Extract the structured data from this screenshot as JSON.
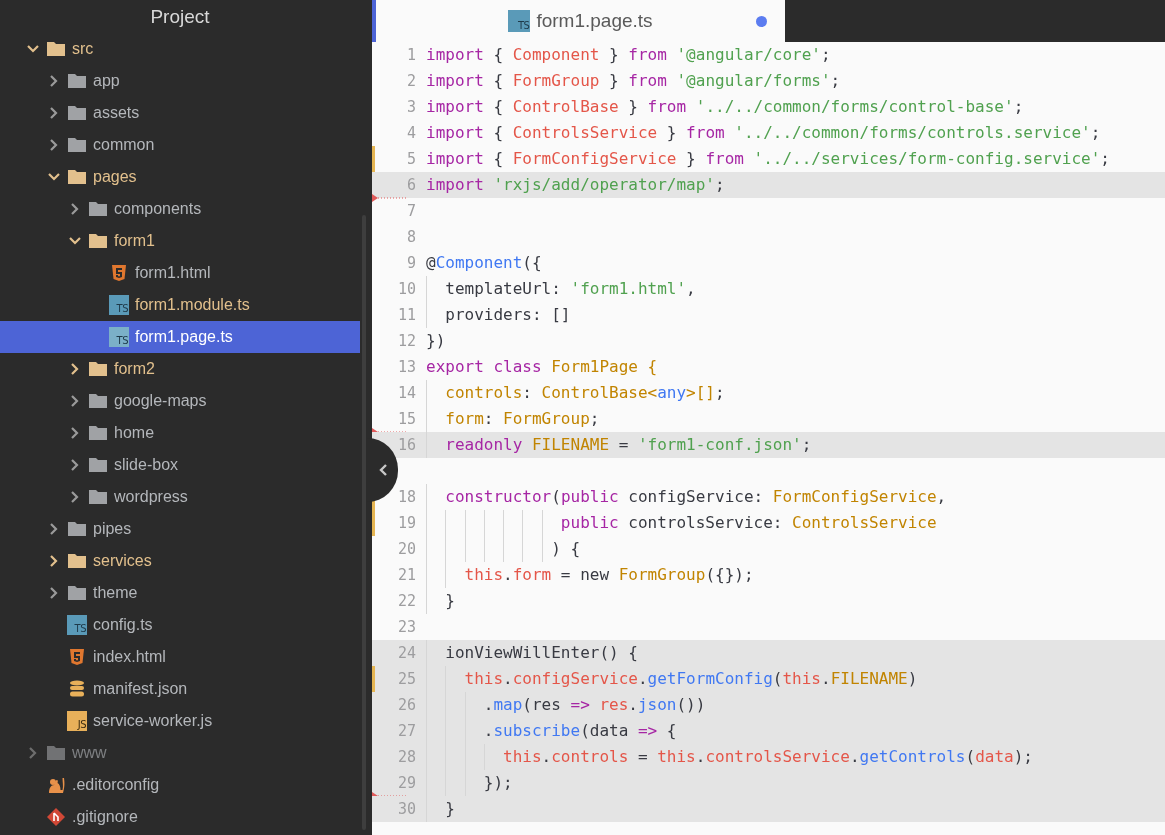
{
  "sidebar": {
    "title": "Project",
    "items": [
      {
        "kind": "folder",
        "label": "src",
        "expanded": true,
        "modified": true,
        "ignored": false,
        "selected": false,
        "children": [
          {
            "kind": "folder",
            "label": "app",
            "expanded": false,
            "modified": false,
            "ignored": false,
            "selected": false
          },
          {
            "kind": "folder",
            "label": "assets",
            "expanded": false,
            "modified": false,
            "ignored": false,
            "selected": false
          },
          {
            "kind": "folder",
            "label": "common",
            "expanded": false,
            "modified": false,
            "ignored": false,
            "selected": false
          },
          {
            "kind": "folder",
            "label": "pages",
            "expanded": true,
            "modified": true,
            "ignored": false,
            "selected": false,
            "children": [
              {
                "kind": "folder",
                "label": "components",
                "expanded": false,
                "modified": false,
                "ignored": false,
                "selected": false
              },
              {
                "kind": "folder",
                "label": "form1",
                "expanded": true,
                "modified": true,
                "ignored": false,
                "selected": false,
                "children": [
                  {
                    "kind": "html",
                    "label": "form1.html",
                    "modified": false,
                    "ignored": false,
                    "selected": false
                  },
                  {
                    "kind": "ts",
                    "icon_label": "TS",
                    "label": "form1.module.ts",
                    "modified": true,
                    "ignored": false,
                    "selected": false
                  },
                  {
                    "kind": "ts",
                    "icon_label": "TS",
                    "label": "form1.page.ts",
                    "modified": false,
                    "ignored": false,
                    "selected": true
                  }
                ]
              },
              {
                "kind": "folder",
                "label": "form2",
                "expanded": false,
                "modified": true,
                "ignored": false,
                "selected": false
              },
              {
                "kind": "folder",
                "label": "google-maps",
                "expanded": false,
                "modified": false,
                "ignored": false,
                "selected": false
              },
              {
                "kind": "folder",
                "label": "home",
                "expanded": false,
                "modified": false,
                "ignored": false,
                "selected": false
              },
              {
                "kind": "folder",
                "label": "slide-box",
                "expanded": false,
                "modified": false,
                "ignored": false,
                "selected": false
              },
              {
                "kind": "folder",
                "label": "wordpress",
                "expanded": false,
                "modified": false,
                "ignored": false,
                "selected": false
              }
            ]
          },
          {
            "kind": "folder",
            "label": "pipes",
            "expanded": false,
            "modified": false,
            "ignored": false,
            "selected": false
          },
          {
            "kind": "folder",
            "label": "services",
            "expanded": false,
            "modified": true,
            "ignored": false,
            "selected": false
          },
          {
            "kind": "folder",
            "label": "theme",
            "expanded": false,
            "modified": false,
            "ignored": false,
            "selected": false
          },
          {
            "kind": "ts",
            "icon_label": "TS",
            "label": "config.ts",
            "modified": false,
            "ignored": false,
            "selected": false
          },
          {
            "kind": "html",
            "label": "index.html",
            "modified": false,
            "ignored": false,
            "selected": false
          },
          {
            "kind": "json",
            "label": "manifest.json",
            "modified": false,
            "ignored": false,
            "selected": false
          },
          {
            "kind": "js",
            "icon_label": "JS",
            "label": "service-worker.js",
            "modified": false,
            "ignored": false,
            "selected": false
          }
        ]
      },
      {
        "kind": "folder",
        "label": "www",
        "expanded": false,
        "modified": false,
        "ignored": true,
        "selected": false
      },
      {
        "kind": "config",
        "label": ".editorconfig",
        "modified": false,
        "ignored": false,
        "selected": false
      },
      {
        "kind": "git",
        "label": ".gitignore",
        "modified": false,
        "ignored": false,
        "selected": false
      }
    ]
  },
  "tab": {
    "icon_label": "TS",
    "title": "form1.page.ts",
    "modified": true,
    "selected": true
  },
  "editor": {
    "lines": [
      {
        "number": "1",
        "highlighted": false,
        "modified": false,
        "deleted_below": false,
        "tokens": [
          {
            "kind": "keyword",
            "text": "import"
          },
          {
            "kind": "plain",
            "text": " { "
          },
          {
            "kind": "name",
            "text": "Component"
          },
          {
            "kind": "plain",
            "text": " } "
          },
          {
            "kind": "keyword",
            "text": "from"
          },
          {
            "kind": "string",
            "text": " '@angular/core'"
          },
          {
            "kind": "plain",
            "text": ";"
          }
        ]
      },
      {
        "number": "2",
        "highlighted": false,
        "modified": false,
        "deleted_below": false,
        "tokens": [
          {
            "kind": "keyword",
            "text": "import"
          },
          {
            "kind": "plain",
            "text": " { "
          },
          {
            "kind": "name",
            "text": "FormGroup"
          },
          {
            "kind": "plain",
            "text": " } "
          },
          {
            "kind": "keyword",
            "text": "from"
          },
          {
            "kind": "string",
            "text": " '@angular/forms'"
          },
          {
            "kind": "plain",
            "text": ";"
          }
        ]
      },
      {
        "number": "3",
        "highlighted": false,
        "modified": false,
        "deleted_below": false,
        "tokens": [
          {
            "kind": "keyword",
            "text": "import"
          },
          {
            "kind": "plain",
            "text": " { "
          },
          {
            "kind": "name",
            "text": "ControlBase"
          },
          {
            "kind": "plain",
            "text": " } "
          },
          {
            "kind": "keyword",
            "text": "from"
          },
          {
            "kind": "string",
            "text": " '../../common/forms/control-base'"
          },
          {
            "kind": "plain",
            "text": ";"
          }
        ]
      },
      {
        "number": "4",
        "highlighted": false,
        "modified": false,
        "deleted_below": false,
        "tokens": [
          {
            "kind": "keyword",
            "text": "import"
          },
          {
            "kind": "plain",
            "text": " { "
          },
          {
            "kind": "name",
            "text": "ControlsService"
          },
          {
            "kind": "plain",
            "text": " } "
          },
          {
            "kind": "keyword",
            "text": "from"
          },
          {
            "kind": "string",
            "text": " '../../common/forms/controls.service'"
          },
          {
            "kind": "plain",
            "text": ";"
          }
        ]
      },
      {
        "number": "5",
        "highlighted": false,
        "modified": true,
        "deleted_below": false,
        "tokens": [
          {
            "kind": "keyword",
            "text": "import"
          },
          {
            "kind": "plain",
            "text": " { "
          },
          {
            "kind": "name",
            "text": "FormConfigService"
          },
          {
            "kind": "plain",
            "text": " } "
          },
          {
            "kind": "keyword",
            "text": "from"
          },
          {
            "kind": "string",
            "text": " '../../services/form-config.service'"
          },
          {
            "kind": "plain",
            "text": ";"
          }
        ]
      },
      {
        "number": "6",
        "highlighted": true,
        "modified": false,
        "deleted_below": true,
        "tokens": [
          {
            "kind": "keyword",
            "text": "import"
          },
          {
            "kind": "string",
            "text": " 'rxjs/add/operator/map'"
          },
          {
            "kind": "plain",
            "text": ";"
          }
        ]
      },
      {
        "number": "7",
        "highlighted": false,
        "modified": false,
        "deleted_below": false
      },
      {
        "number": "8",
        "highlighted": false,
        "modified": false,
        "deleted_below": false
      },
      {
        "number": "9",
        "highlighted": false,
        "modified": false,
        "deleted_below": false,
        "tokens": [
          {
            "kind": "plain",
            "text": "@"
          },
          {
            "kind": "function",
            "text": "Component"
          },
          {
            "kind": "plain",
            "text": "({"
          }
        ]
      },
      {
        "number": "10",
        "highlighted": false,
        "modified": false,
        "deleted_below": false,
        "tokens": [
          {
            "kind": "plain",
            "text": "  templateUrl: "
          },
          {
            "kind": "string",
            "text": "'form1.html'"
          },
          {
            "kind": "plain",
            "text": ","
          }
        ]
      },
      {
        "number": "11",
        "highlighted": false,
        "modified": false,
        "deleted_below": false,
        "tokens": [
          {
            "kind": "plain",
            "text": "  providers: []"
          }
        ]
      },
      {
        "number": "12",
        "highlighted": false,
        "modified": false,
        "deleted_below": false,
        "tokens": [
          {
            "kind": "plain",
            "text": "})"
          }
        ]
      },
      {
        "number": "13",
        "highlighted": false,
        "modified": false,
        "deleted_below": false,
        "tokens": [
          {
            "kind": "keyword",
            "text": "export class"
          },
          {
            "kind": "type",
            "text": " Form1Page {"
          }
        ]
      },
      {
        "number": "14",
        "highlighted": false,
        "modified": false,
        "deleted_below": false,
        "tokens": [
          {
            "kind": "type",
            "text": "  controls"
          },
          {
            "kind": "plain",
            "text": ": "
          },
          {
            "kind": "type",
            "text": "ControlBase<"
          },
          {
            "kind": "function",
            "text": "any"
          },
          {
            "kind": "type",
            "text": ">[]"
          },
          {
            "kind": "plain",
            "text": ";"
          }
        ]
      },
      {
        "number": "15",
        "highlighted": false,
        "modified": false,
        "deleted_below": true,
        "tokens": [
          {
            "kind": "type",
            "text": "  form"
          },
          {
            "kind": "plain",
            "text": ": "
          },
          {
            "kind": "type",
            "text": "FormGroup"
          },
          {
            "kind": "plain",
            "text": ";"
          }
        ]
      },
      {
        "number": "16",
        "highlighted": true,
        "modified": false,
        "deleted_below": false,
        "tokens": [
          {
            "kind": "keyword",
            "text": "  readonly"
          },
          {
            "kind": "type",
            "text": " FILENAME"
          },
          {
            "kind": "plain",
            "text": " = "
          },
          {
            "kind": "string",
            "text": "'form1-conf.json'"
          },
          {
            "kind": "plain",
            "text": ";"
          }
        ]
      },
      {
        "highlighted": false
      },
      {
        "number": "18",
        "highlighted": false,
        "modified": true,
        "deleted_below": false,
        "tokens": [
          {
            "kind": "keyword",
            "text": "  constructor"
          },
          {
            "kind": "plain",
            "text": "("
          },
          {
            "kind": "keyword",
            "text": "public"
          },
          {
            "kind": "plain",
            "text": " configService: "
          },
          {
            "kind": "type",
            "text": "FormConfigService"
          },
          {
            "kind": "plain",
            "text": ","
          }
        ]
      },
      {
        "number": "19",
        "highlighted": false,
        "modified": true,
        "deleted_below": false,
        "tokens": [
          {
            "kind": "keyword",
            "text": "              public"
          },
          {
            "kind": "plain",
            "text": " controlsService: "
          },
          {
            "kind": "type",
            "text": "ControlsService"
          }
        ]
      },
      {
        "number": "20",
        "highlighted": false,
        "modified": false,
        "deleted_below": false,
        "tokens": [
          {
            "kind": "plain",
            "text": "             ) {"
          }
        ]
      },
      {
        "number": "21",
        "highlighted": false,
        "modified": false,
        "deleted_below": false,
        "tokens": [
          {
            "kind": "name",
            "text": "    this"
          },
          {
            "kind": "plain",
            "text": "."
          },
          {
            "kind": "name",
            "text": "form"
          },
          {
            "kind": "plain",
            "text": " = new "
          },
          {
            "kind": "type",
            "text": "FormGroup"
          },
          {
            "kind": "plain",
            "text": "({});"
          }
        ]
      },
      {
        "number": "22",
        "highlighted": false,
        "modified": false,
        "deleted_below": false,
        "tokens": [
          {
            "kind": "plain",
            "text": "  }"
          }
        ]
      },
      {
        "number": "23",
        "highlighted": false,
        "modified": false,
        "deleted_below": false
      },
      {
        "number": "24",
        "highlighted": true,
        "modified": false,
        "deleted_below": false,
        "tokens": [
          {
            "kind": "plain",
            "text": "  ionViewWillEnter() {"
          }
        ]
      },
      {
        "number": "25",
        "highlighted": true,
        "modified": true,
        "deleted_below": false,
        "tokens": [
          {
            "kind": "name",
            "text": "    this"
          },
          {
            "kind": "plain",
            "text": "."
          },
          {
            "kind": "name",
            "text": "configService"
          },
          {
            "kind": "plain",
            "text": "."
          },
          {
            "kind": "function",
            "text": "getFormConfig"
          },
          {
            "kind": "plain",
            "text": "("
          },
          {
            "kind": "name",
            "text": "this"
          },
          {
            "kind": "plain",
            "text": "."
          },
          {
            "kind": "type",
            "text": "FILENAME"
          },
          {
            "kind": "plain",
            "text": ")"
          }
        ]
      },
      {
        "number": "26",
        "highlighted": true,
        "modified": false,
        "deleted_below": false,
        "tokens": [
          {
            "kind": "plain",
            "text": "      ."
          },
          {
            "kind": "function",
            "text": "map"
          },
          {
            "kind": "plain",
            "text": "(res "
          },
          {
            "kind": "keyword",
            "text": "=>"
          },
          {
            "kind": "name",
            "text": " res"
          },
          {
            "kind": "plain",
            "text": "."
          },
          {
            "kind": "function",
            "text": "json"
          },
          {
            "kind": "plain",
            "text": "())"
          }
        ]
      },
      {
        "number": "27",
        "highlighted": true,
        "modified": false,
        "deleted_below": false,
        "tokens": [
          {
            "kind": "plain",
            "text": "      ."
          },
          {
            "kind": "function",
            "text": "subscribe"
          },
          {
            "kind": "plain",
            "text": "(data "
          },
          {
            "kind": "keyword",
            "text": "=>"
          },
          {
            "kind": "plain",
            "text": " {"
          }
        ]
      },
      {
        "number": "28",
        "highlighted": true,
        "modified": false,
        "deleted_below": false,
        "tokens": [
          {
            "kind": "name",
            "text": "        this"
          },
          {
            "kind": "plain",
            "text": "."
          },
          {
            "kind": "name",
            "text": "controls"
          },
          {
            "kind": "plain",
            "text": " = "
          },
          {
            "kind": "name",
            "text": "this"
          },
          {
            "kind": "plain",
            "text": "."
          },
          {
            "kind": "name",
            "text": "controlsService"
          },
          {
            "kind": "plain",
            "text": "."
          },
          {
            "kind": "function",
            "text": "getControls"
          },
          {
            "kind": "plain",
            "text": "("
          },
          {
            "kind": "name",
            "text": "data"
          },
          {
            "kind": "plain",
            "text": ");"
          }
        ]
      },
      {
        "number": "29",
        "highlighted": true,
        "modified": false,
        "deleted_below": true,
        "tokens": [
          {
            "kind": "plain",
            "text": "      });"
          }
        ]
      },
      {
        "number": "30",
        "highlighted": true,
        "modified": false,
        "deleted_below": false,
        "tokens": [
          {
            "kind": "plain",
            "text": "  }"
          }
        ]
      }
    ]
  }
}
